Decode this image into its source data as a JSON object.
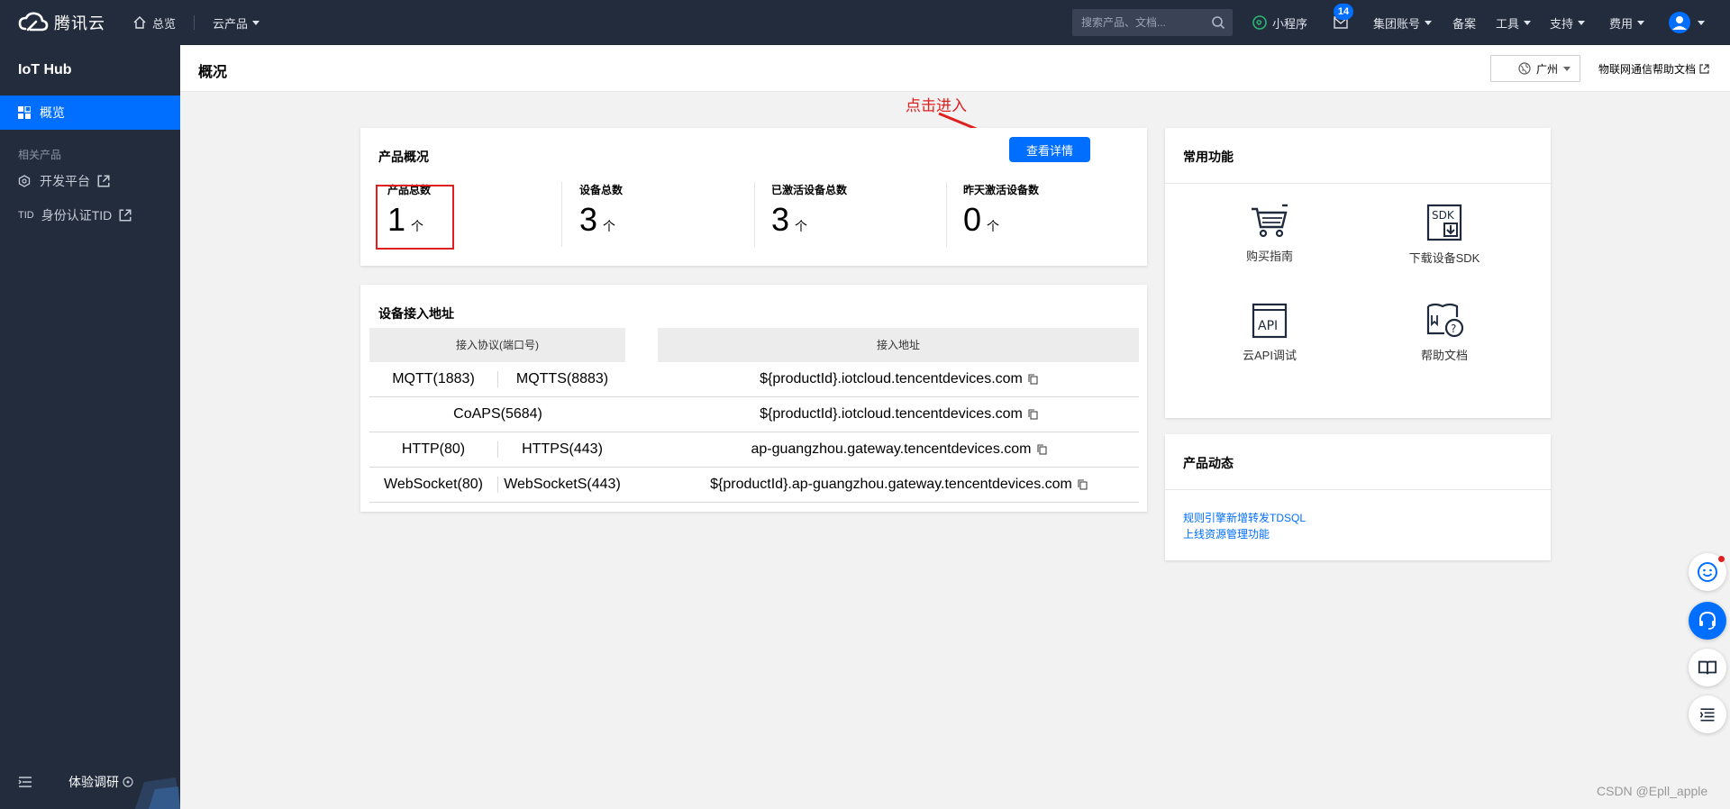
{
  "topbar": {
    "logo_text": "腾讯云",
    "home": "总览",
    "products": "云产品",
    "search_placeholder": "搜索产品、文档...",
    "miniprogram": "小程序",
    "mail_badge": "14",
    "account": "集团账号",
    "beian": "备案",
    "tools": "工具",
    "support": "支持",
    "billing": "费用"
  },
  "sidebar": {
    "title": "IoT Hub",
    "active_item": "概览",
    "group_label": "相关产品",
    "items": [
      {
        "label": "开发平台"
      },
      {
        "label": "身份认证TID"
      }
    ],
    "footer_label": "体验调研"
  },
  "page": {
    "title": "概况",
    "region": "广州",
    "help_link": "物联网通信帮助文档"
  },
  "annotation": "点击进入",
  "overview": {
    "title": "产品概况",
    "detail_button": "查看详情",
    "unit": "个",
    "stats": [
      {
        "label": "产品总数",
        "value": "1"
      },
      {
        "label": "设备总数",
        "value": "3"
      },
      {
        "label": "已激活设备总数",
        "value": "3"
      },
      {
        "label": "昨天激活设备数",
        "value": "0"
      }
    ]
  },
  "address": {
    "title": "设备接入地址",
    "col_protocol": "接入协议(端口号)",
    "col_address": "接入地址",
    "rows": [
      {
        "p1": "MQTT(1883)",
        "p2": "MQTTS(8883)",
        "addr": "${productId}.iotcloud.tencentdevices.com"
      },
      {
        "p1": "CoAPS(5684)",
        "p2": "",
        "addr": "${productId}.iotcloud.tencentdevices.com"
      },
      {
        "p1": "HTTP(80)",
        "p2": "HTTPS(443)",
        "addr": "ap-guangzhou.gateway.tencentdevices.com"
      },
      {
        "p1": "WebSocket(80)",
        "p2": "WebSocketS(443)",
        "addr": "${productId}.ap-guangzhou.gateway.tencentdevices.com"
      }
    ]
  },
  "functions": {
    "title": "常用功能",
    "items": [
      {
        "label": "购买指南",
        "icon": "cart-icon"
      },
      {
        "label": "下载设备SDK",
        "icon": "sdk-download-icon"
      },
      {
        "label": "云API调试",
        "icon": "api-icon"
      },
      {
        "label": "帮助文档",
        "icon": "help-doc-icon"
      }
    ]
  },
  "news": {
    "title": "产品动态",
    "links": [
      "规则引擎新增转发TDSQL",
      "上线资源管理功能"
    ]
  },
  "watermark": "CSDN @Epll_apple",
  "colors": {
    "accent": "#006eff",
    "nav_bg": "#232c3d",
    "annotation": "#e02020"
  }
}
